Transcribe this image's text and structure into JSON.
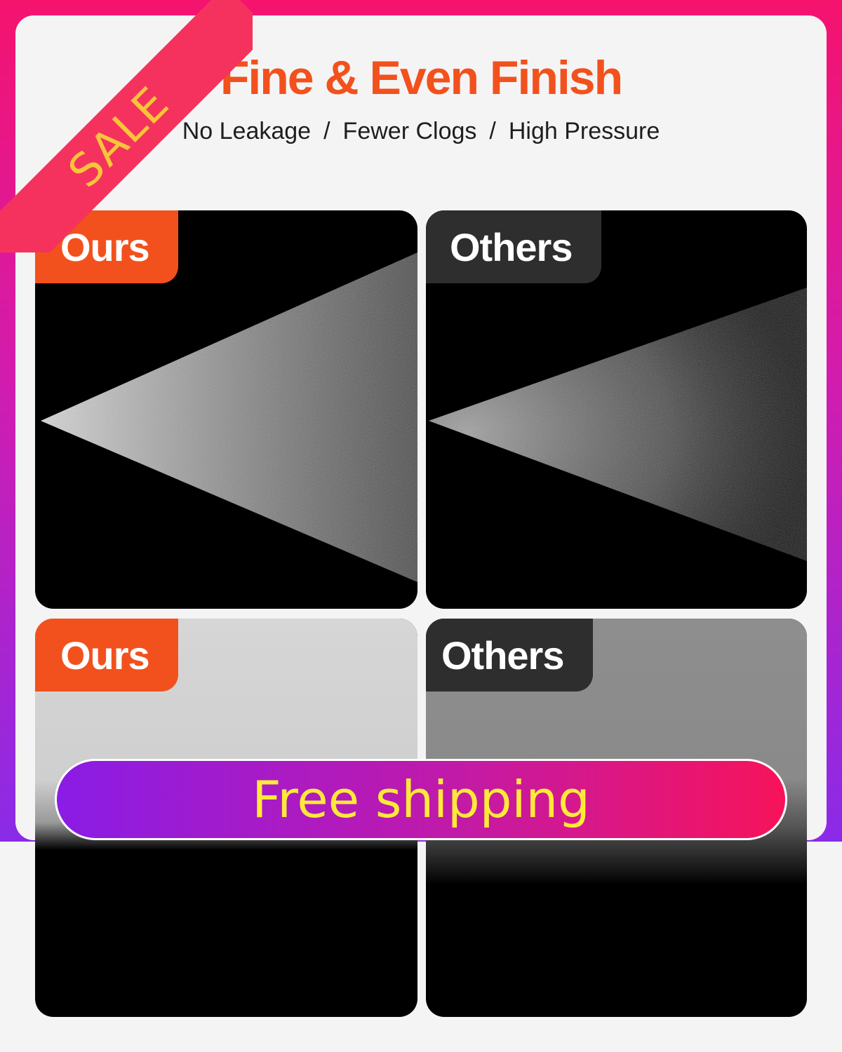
{
  "header": {
    "title": "Fine & Even Finish",
    "features": [
      "No Leakage",
      "Fewer Clogs",
      "High Pressure"
    ],
    "separator": "/"
  },
  "ribbon": {
    "label": "SALE"
  },
  "panels": [
    {
      "tag": "Ours"
    },
    {
      "tag": "Others"
    },
    {
      "tag": "Ours"
    },
    {
      "tag": "Others"
    }
  ],
  "banner": {
    "label": "Free shipping"
  },
  "colors": {
    "accent_orange": "#f2511d",
    "dark_tag": "#2e2e2e",
    "banner_gradient_start": "#8a1ce6",
    "banner_gradient_end": "#f7135a",
    "banner_text": "#ffea3a",
    "ribbon": "#f5325e",
    "ribbon_text": "#f7c43a"
  }
}
